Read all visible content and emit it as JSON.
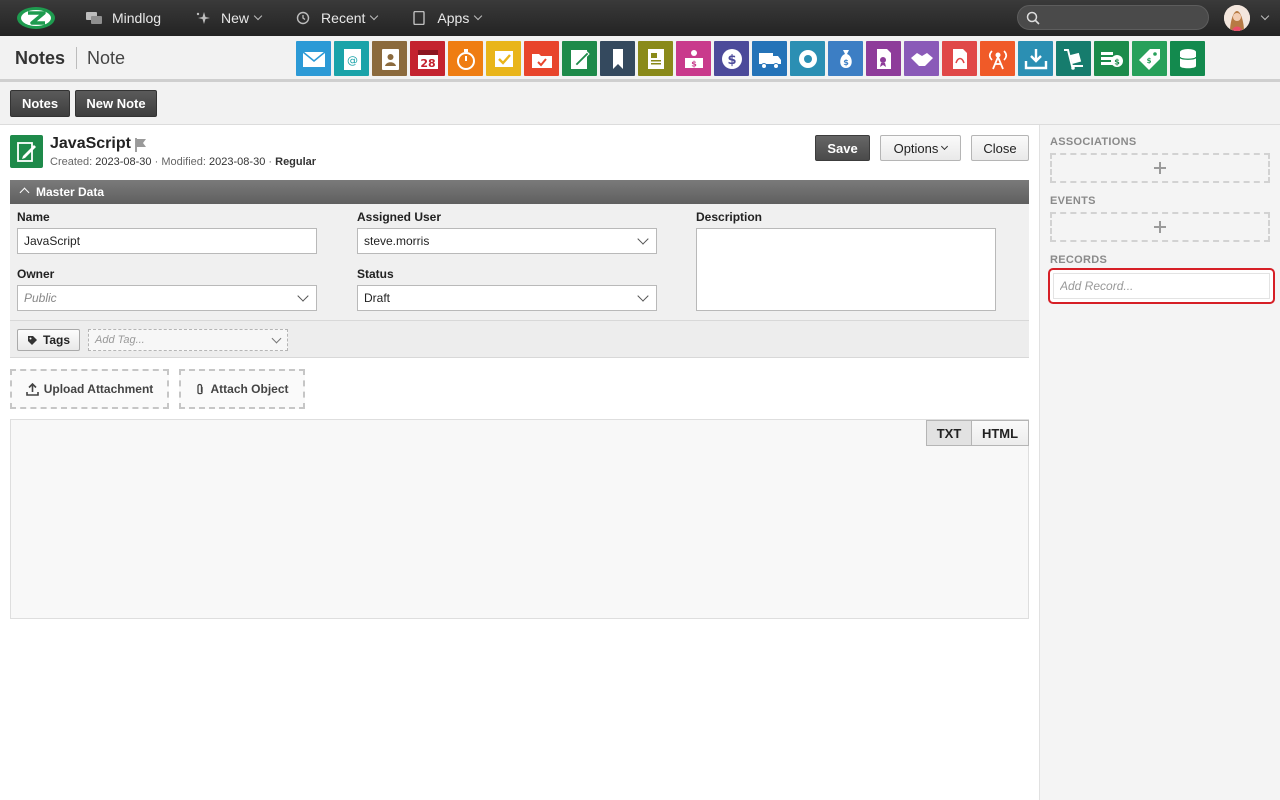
{
  "topnav": {
    "items": [
      {
        "label": "Mindlog",
        "icon": "messages-icon"
      },
      {
        "label": "New",
        "icon": "sparkle-icon"
      },
      {
        "label": "Recent",
        "icon": "history-icon"
      },
      {
        "label": "Apps",
        "icon": "tablet-icon"
      }
    ],
    "search_placeholder": ""
  },
  "header": {
    "module": "Notes",
    "record_type": "Note"
  },
  "subbar": {
    "notes_label": "Notes",
    "new_note_label": "New Note"
  },
  "record": {
    "name": "JavaScript",
    "created_label": "Created:",
    "created": "2023-08-30",
    "modified_label": "Modified:",
    "modified": "2023-08-30",
    "sep": "·",
    "status_tag": "Regular"
  },
  "actions": {
    "save": "Save",
    "options": "Options",
    "close": "Close"
  },
  "master": {
    "title": "Master Data",
    "name_label": "Name",
    "name_value": "JavaScript",
    "assigned_label": "Assigned User",
    "assigned_value": "steve.morris",
    "description_label": "Description",
    "owner_label": "Owner",
    "owner_value": "Public",
    "status_label": "Status",
    "status_value": "Draft"
  },
  "tags": {
    "button": "Tags",
    "placeholder": "Add Tag..."
  },
  "attach": {
    "upload": "Upload Attachment",
    "object": "Attach Object"
  },
  "editor": {
    "txt": "TXT",
    "html": "HTML"
  },
  "sidebar": {
    "associations": "ASSOCIATIONS",
    "events": "EVENTS",
    "records": "RECORDS",
    "add_record_placeholder": "Add Record..."
  },
  "colors": {
    "accent_red": "#d61f26",
    "note_green": "#1e8a4a",
    "apps": [
      "#2c9ad6",
      "#1aa3a9",
      "#8b6a3d",
      "#c4232f",
      "#ef7d12",
      "#e9b51a",
      "#e8452c",
      "#1e8a4a",
      "#34495e",
      "#8a8a1a",
      "#c93a8c",
      "#4c4a9a",
      "#2473b8",
      "#2b8fb3",
      "#3c7ec4",
      "#8e3c9a",
      "#8a5ab8",
      "#e04848",
      "#f05a28",
      "#2b8fb3",
      "#167c6d",
      "#1c8b4b",
      "#27a05a",
      "#138a4e"
    ]
  }
}
